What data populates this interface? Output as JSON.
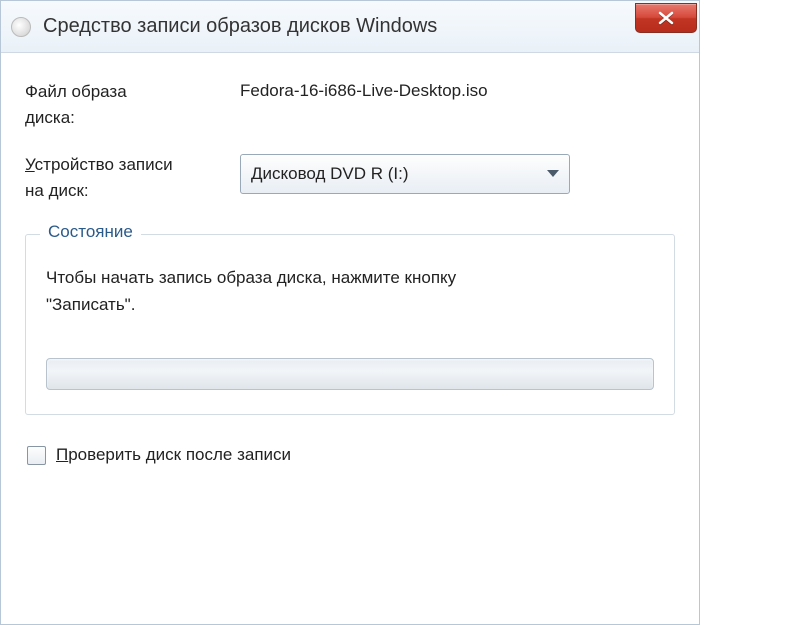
{
  "window": {
    "title": "Средство записи образов дисков Windows"
  },
  "fields": {
    "file_label_line1": "Файл образа",
    "file_label_line2": "диска:",
    "file_value": "Fedora-16-i686-Live-Desktop.iso",
    "device_label_accel": "У",
    "device_label_rest1": "стройство записи",
    "device_label_rest2": "на диск:",
    "device_value": "Дисковод DVD R (I:)"
  },
  "status": {
    "group_title": "Состояние",
    "text_line1": "Чтобы начать запись образа диска, нажмите кнопку",
    "text_line2": "\"Записать\"."
  },
  "verify": {
    "accel": "П",
    "rest": "роверить диск после записи"
  }
}
